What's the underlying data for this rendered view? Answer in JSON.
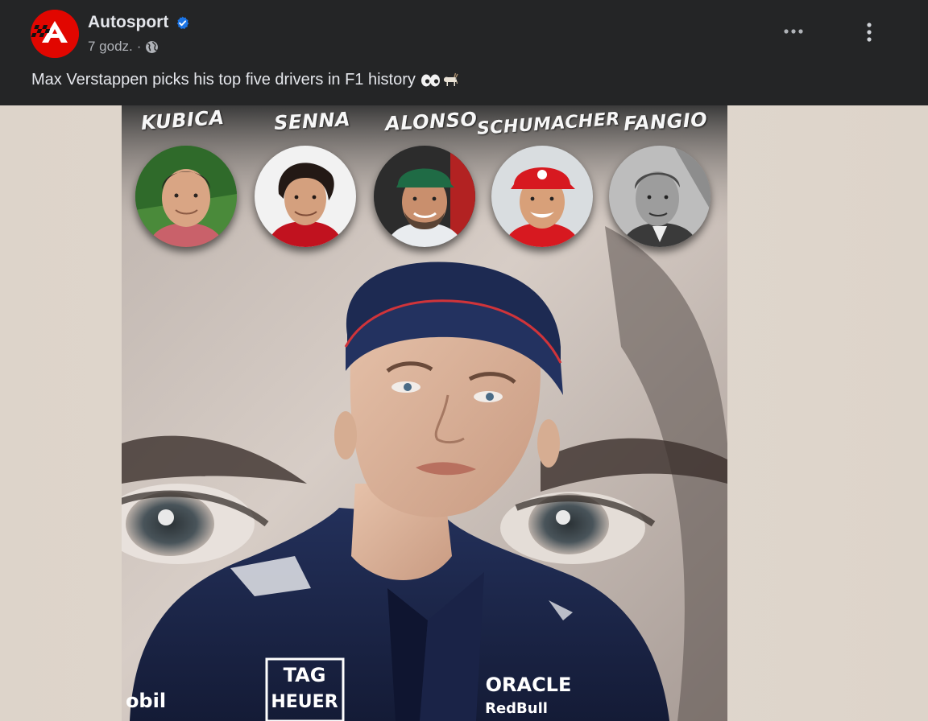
{
  "post": {
    "author": "Autosport",
    "time": "7 godz.",
    "separator": "·",
    "text": "Max Verstappen picks his top five drivers in F1 history",
    "emoji": [
      "eyes",
      "goat"
    ]
  },
  "icons": {
    "avatar": "autosport-logo",
    "verified": "verified-badge-icon",
    "privacy": "globe-icon",
    "more": "more-horizontal-icon",
    "options": "more-vertical-icon"
  },
  "image": {
    "drivers": [
      {
        "name": "KUBICA"
      },
      {
        "name": "SENNA"
      },
      {
        "name": "ALONSO"
      },
      {
        "name": "SCHUMACHER"
      },
      {
        "name": "FANGIO"
      }
    ],
    "jacket_logos": {
      "tag": "TAG",
      "heuer": "HEUER",
      "oracle": "ORACLE",
      "redbull": "RedBull",
      "mobil": "obil"
    }
  },
  "colors": {
    "header_bg": "#242526",
    "text_primary": "#e4e6eb",
    "text_secondary": "#b0b3b8",
    "verified": "#1b74e4",
    "brand_red": "#e10600"
  }
}
